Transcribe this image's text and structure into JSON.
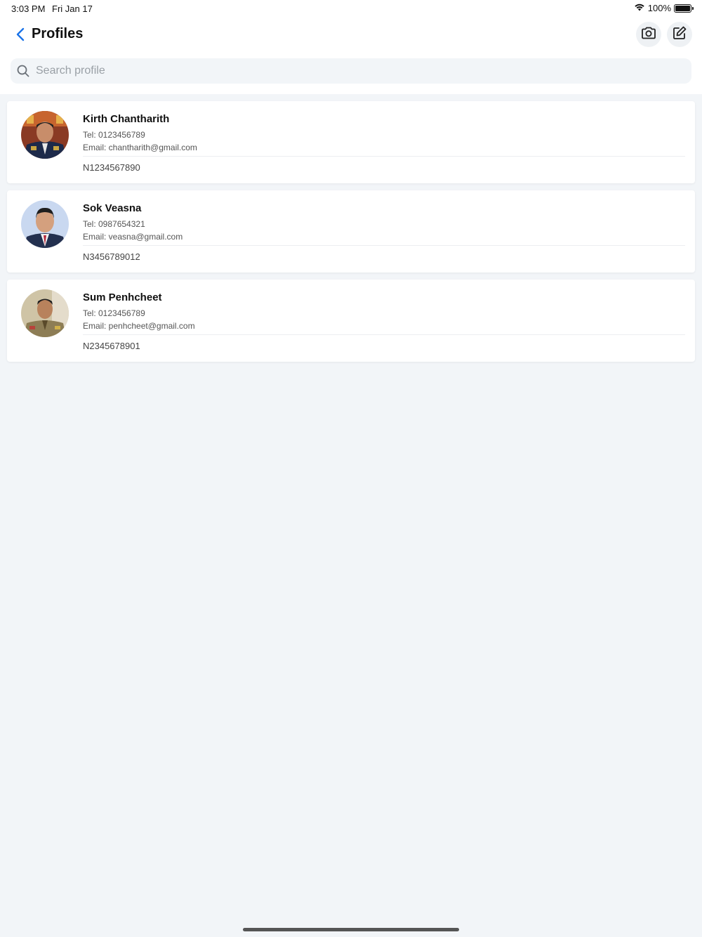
{
  "status_bar": {
    "time": "3:03 PM",
    "date": "Fri Jan 17",
    "battery": "100%",
    "battery_level": 1.0
  },
  "header": {
    "title": "Profiles",
    "back_icon": "chevron-left-icon",
    "camera_icon": "camera-icon",
    "edit_icon": "edit-icon"
  },
  "search": {
    "placeholder": "Search profile",
    "value": ""
  },
  "colors": {
    "accent": "#1a73e8",
    "background": "#f2f5f8",
    "card": "#ffffff"
  },
  "profiles": [
    {
      "name": "Kirth Chantharith",
      "tel": "Tel: 0123456789",
      "email": "Email: chantharith@gmail.com",
      "id_number": "N1234567890"
    },
    {
      "name": "Sok Veasna",
      "tel": "Tel: 0987654321",
      "email": "Email: veasna@gmail.com",
      "id_number": "N3456789012"
    },
    {
      "name": "Sum Penhcheet",
      "tel": "Tel: 0123456789",
      "email": "Email: penhcheet@gmail.com",
      "id_number": "N2345678901"
    }
  ]
}
